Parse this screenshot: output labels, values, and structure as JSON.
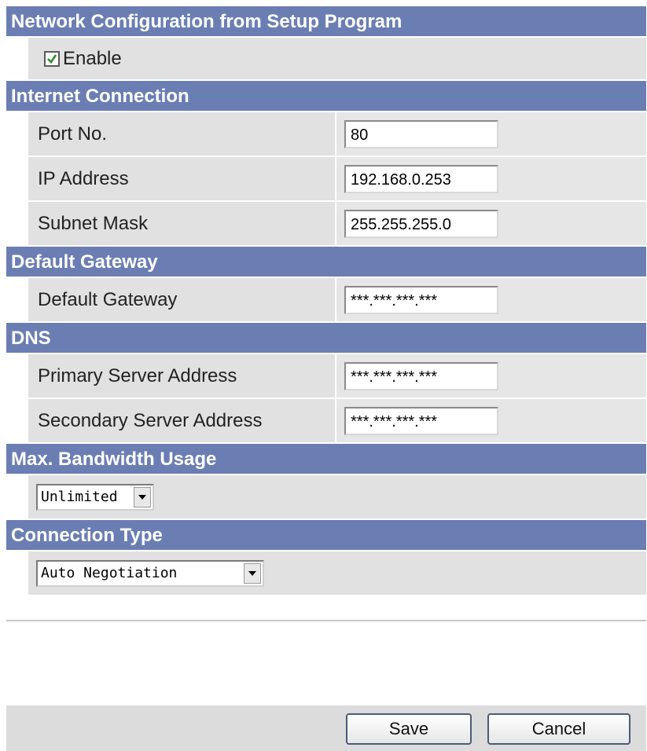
{
  "sections": {
    "setup": {
      "title": "Network Configuration from Setup Program",
      "enable_label": "Enable",
      "enable_checked": true
    },
    "internet": {
      "title": "Internet Connection",
      "port_label": "Port No.",
      "port_value": "80",
      "ip_label": "IP Address",
      "ip_value": "192.168.0.253",
      "subnet_label": "Subnet Mask",
      "subnet_value": "255.255.255.0"
    },
    "gateway": {
      "title": "Default Gateway",
      "label": "Default Gateway",
      "value": "***.***.***.***"
    },
    "dns": {
      "title": "DNS",
      "primary_label": "Primary Server Address",
      "primary_value": "***.***.***.***",
      "secondary_label": "Secondary Server Address",
      "secondary_value": "***.***.***.***"
    },
    "bandwidth": {
      "title": "Max. Bandwidth Usage",
      "selected": "Unlimited"
    },
    "connection": {
      "title": "Connection Type",
      "selected": "Auto Negotiation"
    }
  },
  "footer": {
    "save_label": "Save",
    "cancel_label": "Cancel"
  },
  "icons": {
    "checkbox": "check-icon",
    "dropdown": "chevron-down-icon"
  },
  "colors": {
    "header_bg": "#6b7eb3",
    "row_bg": "#e1e1e1",
    "checkmark": "#2e8b2e"
  }
}
